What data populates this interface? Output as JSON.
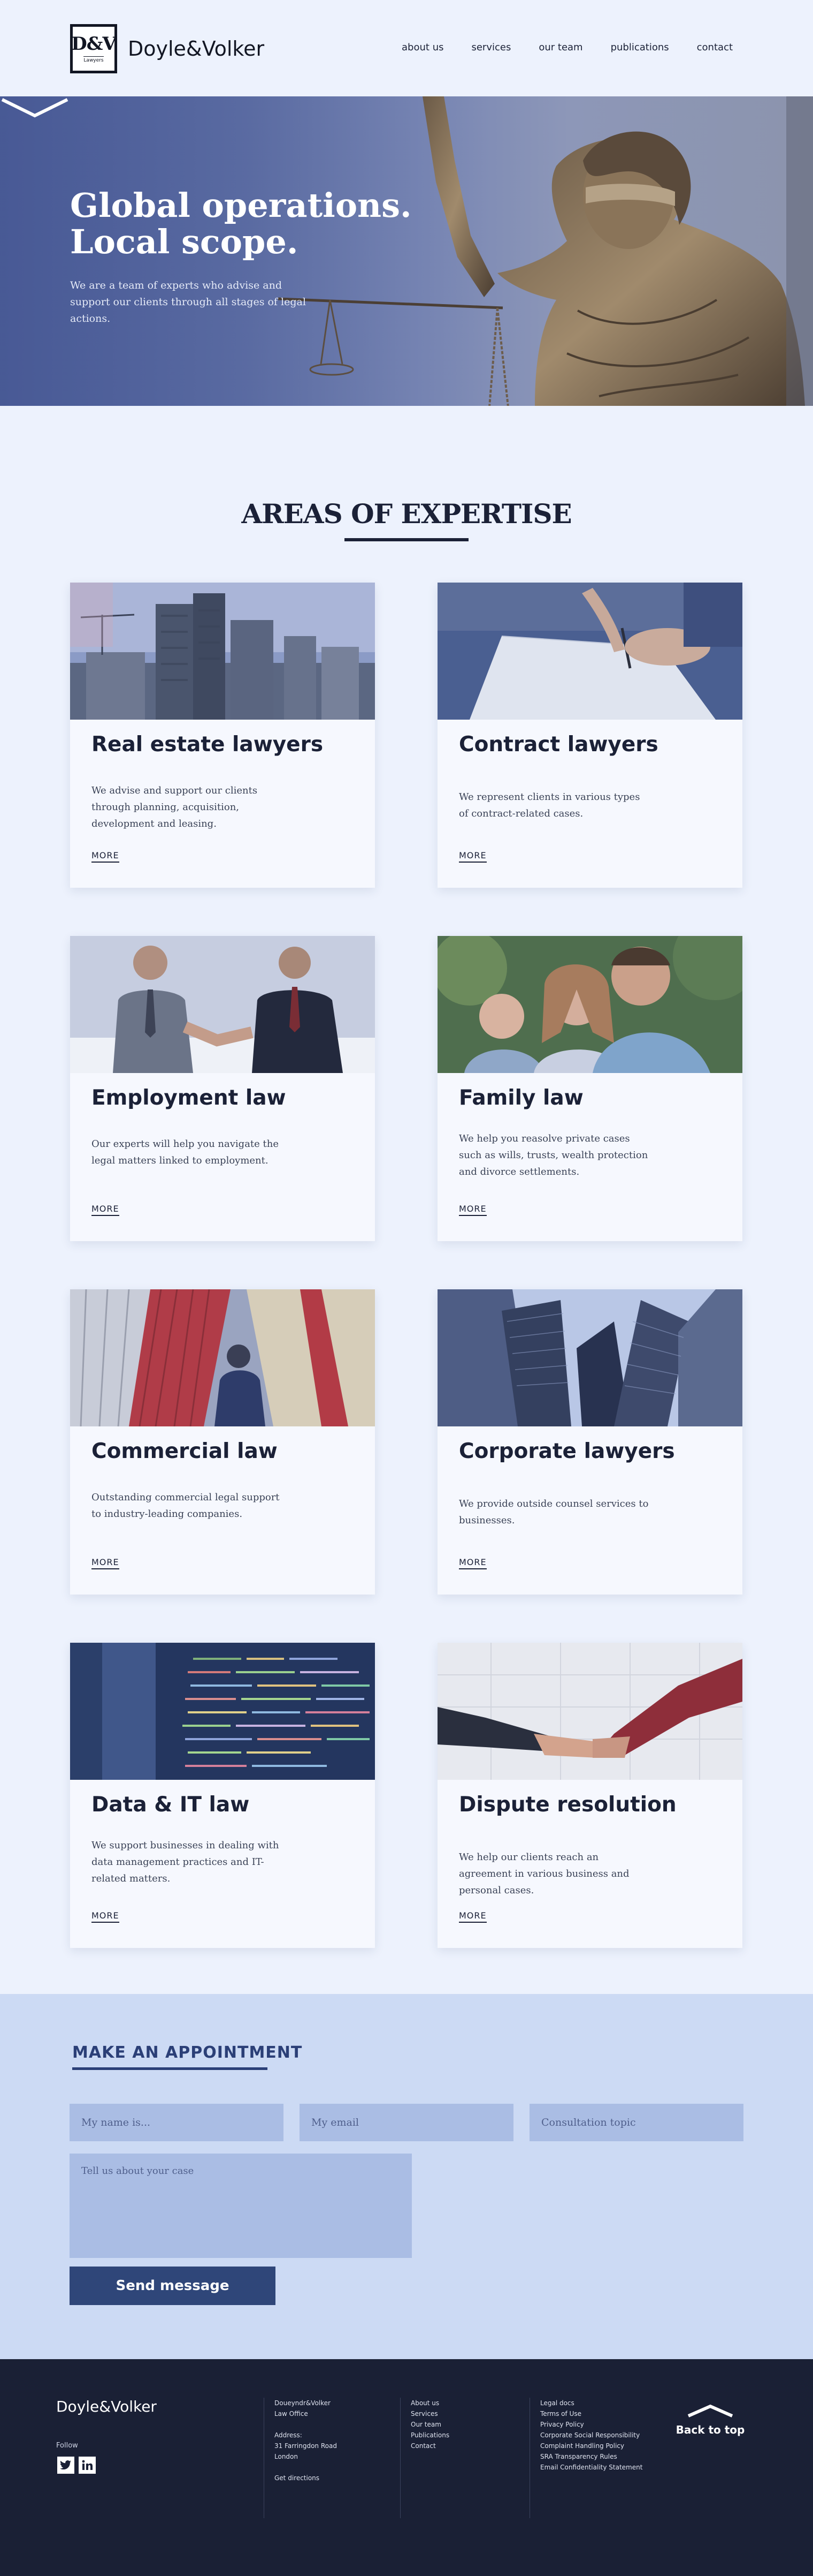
{
  "header": {
    "logo_mark": "D&V",
    "logo_tag": "Lawyers",
    "logo_name": "Doyle&Volker",
    "nav": [
      "about us",
      "services",
      "our team",
      "publications",
      "contact"
    ]
  },
  "hero": {
    "title_line1": "Global operations.",
    "title_line2": "Local scope.",
    "subtitle": "We are a team of experts who advise and support our clients through all stages of legal actions."
  },
  "expertise": {
    "title": "AREAS OF EXPERTISE",
    "more_label": "MORE",
    "cards": [
      {
        "title": "Real estate lawyers",
        "text": "We advise and support our clients through planning, acquisition, development and leasing.",
        "image": "construction-site"
      },
      {
        "title": "Contract lawyers",
        "text": "We represent clients in various types of contract-related cases.",
        "image": "signing-contract"
      },
      {
        "title": "Employment law",
        "text": "Our experts will help you navigate the legal matters linked to employment.",
        "image": "business-handshake"
      },
      {
        "title": "Family law",
        "text": "We help you reasolve private cases such as wills, trusts, wealth protection and divorce settlements.",
        "image": "family-portrait"
      },
      {
        "title": "Commercial law",
        "text": "Outstanding commercial legal support to industry-leading companies.",
        "image": "shipping-containers"
      },
      {
        "title": "Corporate lawyers",
        "text": "We provide outside counsel services to businesses.",
        "image": "skyscrapers"
      },
      {
        "title": "Data & IT law",
        "text": "We support businesses in dealing with data management practices and IT-related matters.",
        "image": "code-screen"
      },
      {
        "title": "Dispute resolution",
        "text": "We help our clients reach an agreement in various business and personal cases.",
        "image": "agreement-handshake"
      }
    ]
  },
  "appointment": {
    "title": "MAKE AN APPOINTMENT",
    "name_placeholder": "My name is...",
    "email_placeholder": "My email",
    "topic_placeholder": "Consultation topic",
    "message_placeholder": "Tell us about your case",
    "send_label": "Send message"
  },
  "footer": {
    "logo_name": "Doyle&Volker",
    "follow_label": "Follow",
    "social": [
      "twitter-icon",
      "linkedin-icon"
    ],
    "office": [
      "Doueyndr&Volker",
      "Law Office",
      "",
      "Address:",
      "31 Farringdon Road",
      "London",
      "",
      "Get directions"
    ],
    "links": [
      "About us",
      "Services",
      "Our team",
      "Publications",
      "Contact"
    ],
    "legal": [
      "Legal docs",
      "Terms of Use",
      "Privacy Policy",
      "Corporate Social Responsibility",
      "Complaint Handling Policy",
      "SRA Transparency Rules",
      "Email Confidentiality Statement"
    ],
    "back_to_top": "Back to top"
  },
  "colors": {
    "page_bg": "#edf2fd",
    "hero_blue": "#5a6ba3",
    "navy": "#1b2137",
    "appointment_bg": "#ccdaf4",
    "button_blue": "#2f4679",
    "footer_bg": "#1a2035"
  }
}
